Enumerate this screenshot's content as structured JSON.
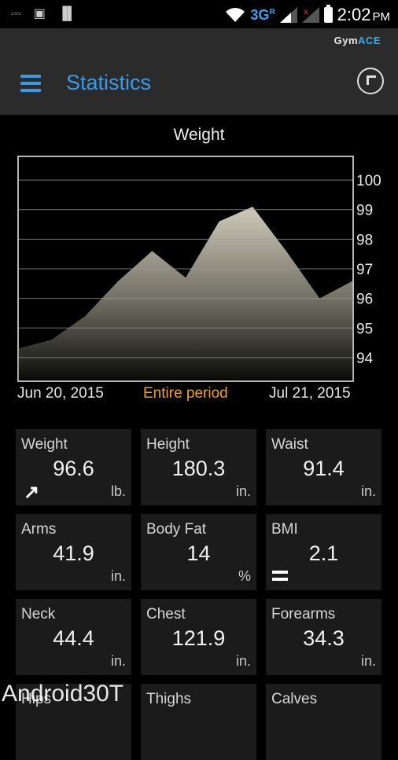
{
  "status_bar": {
    "left_icons": [
      "usb-icon",
      "image-icon",
      "barcode-icon"
    ],
    "network": "3G",
    "network_sup": "R",
    "time": "2:02",
    "ampm": "PM"
  },
  "app_bar": {
    "brand_prefix": "GymACE",
    "title": "Statistics"
  },
  "chart_data": {
    "type": "area",
    "title": "Weight",
    "x_start": "Jun 20, 2015",
    "x_end": "Jul 21, 2015",
    "period_label": "Entire period",
    "ylim": [
      93.2,
      100.8
    ],
    "yticks": [
      100,
      99,
      98,
      97,
      96,
      95,
      94
    ],
    "grid": true,
    "y": [
      94.3,
      94.6,
      95.4,
      96.6,
      97.6,
      96.7,
      98.6,
      99.1,
      97.6,
      96.0,
      96.6
    ],
    "x": [
      "Jun 20, 2015",
      "",
      "",
      "",
      "",
      "",
      "",
      "",
      "",
      "",
      "Jul 21, 2015"
    ]
  },
  "stats": [
    {
      "name": "Weight",
      "value": "96.6",
      "unit": "lb.",
      "trend": "up"
    },
    {
      "name": "Height",
      "value": "180.3",
      "unit": "in."
    },
    {
      "name": "Waist",
      "value": "91.4",
      "unit": "in."
    },
    {
      "name": "Arms",
      "value": "41.9",
      "unit": "in."
    },
    {
      "name": "Body Fat",
      "value": "14",
      "unit": "%"
    },
    {
      "name": "BMI",
      "value": "2.1",
      "unit": "",
      "trend": "equal"
    },
    {
      "name": "Neck",
      "value": "44.4",
      "unit": "in."
    },
    {
      "name": "Chest",
      "value": "121.9",
      "unit": "in."
    },
    {
      "name": "Forearms",
      "value": "34.3",
      "unit": "in."
    },
    {
      "name": "Hips",
      "value": "",
      "unit": ""
    },
    {
      "name": "Thighs",
      "value": "",
      "unit": ""
    },
    {
      "name": "Calves",
      "value": "",
      "unit": ""
    }
  ],
  "watermark": "Android30T",
  "colors": {
    "accent_blue": "#3a9ae8",
    "period_orange": "#f0a030",
    "tile_bg": "#1b1b1b",
    "actionbar_bg": "#2b2b2b"
  }
}
